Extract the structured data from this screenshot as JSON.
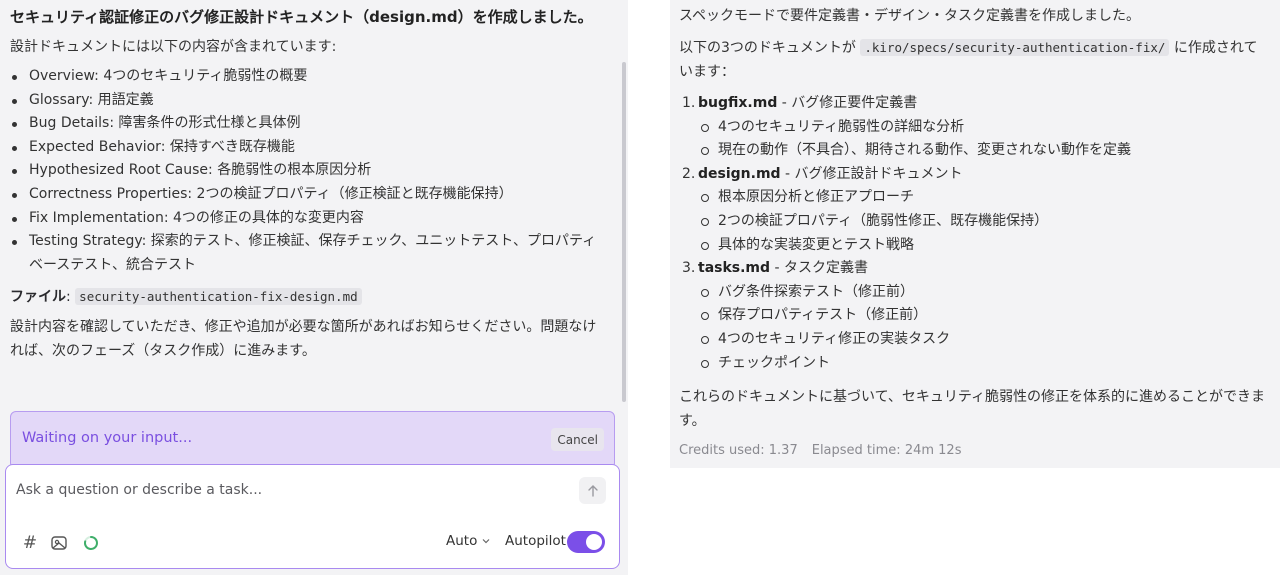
{
  "left": {
    "title": "セキュリティ認証修正のバグ修正設計ドキュメント（design.md）を作成しました。",
    "intro": "設計ドキュメントには以下の内容が含まれています:",
    "bullets": [
      "Overview: 4つのセキュリティ脆弱性の概要",
      "Glossary: 用語定義",
      "Bug Details: 障害条件の形式仕様と具体例",
      "Expected Behavior: 保持すべき既存機能",
      "Hypothesized Root Cause: 各脆弱性の根本原因分析",
      "Correctness Properties: 2つの検証プロパティ（修正検証と既存機能保持）",
      "Fix Implementation: 4つの修正の具体的な変更内容",
      "Testing Strategy: 探索的テスト、修正検証、保存チェック、ユニットテスト、プロパティベーステスト、統合テスト"
    ],
    "file_label": "ファイル",
    "file_name": "security-authentication-fix-design.md",
    "closing": "設計内容を確認していただき、修正や追加が必要な箇所があればお知らせください。問題なければ、次のフェーズ（タスク作成）に進みます。"
  },
  "waiting": {
    "text": "Waiting on your input...",
    "cancel_label": "Cancel"
  },
  "input": {
    "placeholder": "Ask a question or describe a task...",
    "mode_label": "Auto",
    "autopilot_label": "Autopilot",
    "autopilot_on": true
  },
  "right": {
    "line1": "スペックモードで要件定義書・デザイン・タスク定義書を作成しました。",
    "line2_prefix": "以下の3つのドキュメントが",
    "line2_path": ".kiro/specs/security-authentication-fix/",
    "line2_suffix": "に作成されています：",
    "docs": [
      {
        "number": "1.",
        "name": "bugfix.md",
        "desc": " - バグ修正要件定義書",
        "items": [
          "4つのセキュリティ脆弱性の詳細な分析",
          "現在の動作（不具合）、期待される動作、変更されない動作を定義"
        ]
      },
      {
        "number": "2.",
        "name": "design.md",
        "desc": " - バグ修正設計ドキュメント",
        "items": [
          "根本原因分析と修正アプローチ",
          "2つの検証プロパティ（脆弱性修正、既存機能保持）",
          "具体的な実装変更とテスト戦略"
        ]
      },
      {
        "number": "3.",
        "name": "tasks.md",
        "desc": " - タスク定義書",
        "items": [
          "バグ条件探索テスト（修正前）",
          "保存プロパティテスト（修正前）",
          "4つのセキュリティ修正の実装タスク",
          "チェックポイント"
        ]
      }
    ],
    "conclusion": "これらのドキュメントに基づいて、セキュリティ脆弱性の修正を体系的に進めることができます。",
    "credits": "Credits used: 1.37",
    "elapsed": "Elapsed time: 24m 12s"
  },
  "colors": {
    "accent": "#7b4fe8",
    "waiting_bg": "#e3d8f8",
    "panel_bg": "#f3f3f5"
  },
  "icons": [
    "hash-icon",
    "image-icon",
    "spinner-icon",
    "send-arrow-icon",
    "chevron-down-icon"
  ]
}
